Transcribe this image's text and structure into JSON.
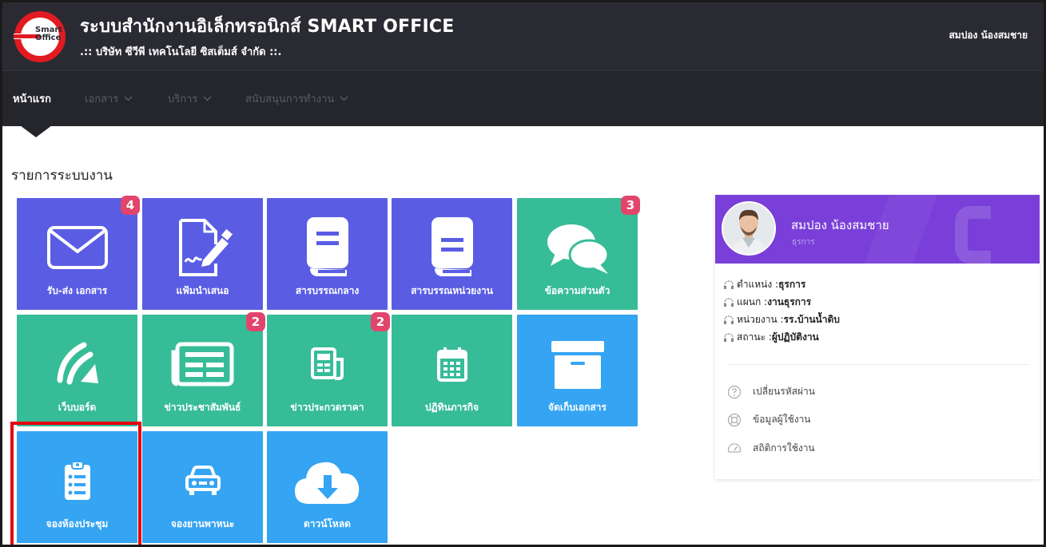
{
  "header": {
    "logo_text_top": "Smart",
    "logo_text_bottom": "Office",
    "title": "ระบบสำนักงานอิเล็กทรอนิกส์ SMART OFFICE",
    "company": ".:: บริษัท ซีวีพี เทคโนโลยี ซิสเต็มส์ จำกัด ::.",
    "user": "สมปอง น้องสมชาย"
  },
  "nav": {
    "items": [
      {
        "label": "หน้าแรก",
        "active": true
      },
      {
        "label": "เอกสาร"
      },
      {
        "label": "บริการ"
      },
      {
        "label": "สนับสนุนการทำงาน"
      }
    ]
  },
  "section_title": "รายการระบบงาน",
  "tiles": [
    {
      "label": "รับ-ส่ง เอกสาร",
      "icon": "envelope-icon",
      "color": "#5a5de3",
      "badge": "4"
    },
    {
      "label": "แฟ้มนำเสนอ",
      "icon": "document-sign-icon",
      "color": "#5a5de3"
    },
    {
      "label": "สารบรรณกลาง",
      "icon": "book-icon",
      "color": "#5a5de3"
    },
    {
      "label": "สารบรรณหน่วยงาน",
      "icon": "book-icon",
      "color": "#5a5de3"
    },
    {
      "label": "ข้อความส่วนตัว",
      "icon": "chat-bubbles-icon",
      "color": "#37bc98",
      "badge": "3"
    },
    {
      "label": "เว็บบอร์ด",
      "icon": "webboard-icon",
      "color": "#37bc98"
    },
    {
      "label": "ข่าวประชาสัมพันธ์",
      "icon": "newspaper-icon",
      "color": "#37bc98",
      "badge": "2"
    },
    {
      "label": "ข่าวประกวดราคา",
      "icon": "newspaper-small-icon",
      "color": "#37bc98",
      "badge": "2"
    },
    {
      "label": "ปฏิทินภารกิจ",
      "icon": "calendar-icon",
      "color": "#37bc98"
    },
    {
      "label": "จัดเก็บเอกสาร",
      "icon": "archive-box-icon",
      "color": "#35a4f2"
    },
    {
      "label": "จองห้องประชุม",
      "icon": "clipboard-list-icon",
      "color": "#35a4f2",
      "highlighted": true
    },
    {
      "label": "จองยานพาหนะ",
      "icon": "car-icon",
      "color": "#35a4f2"
    },
    {
      "label": "ดาวน์โหลด",
      "icon": "cloud-download-icon",
      "color": "#35a4f2"
    }
  ],
  "profile": {
    "name": "สมปอง น้องสมชาย",
    "role": "ธุรการ",
    "info": [
      {
        "label": "ตำแหน่ง : ",
        "value": "ธุรการ"
      },
      {
        "label": "แผนก : ",
        "value": "งานธุรการ"
      },
      {
        "label": "หน่วยงาน : ",
        "value": "รร.บ้านน้ำดิบ"
      },
      {
        "label": "สถานะ : ",
        "value": "ผู้ปฏิบัติงาน"
      }
    ],
    "links": [
      {
        "label": "เปลี่ยนรหัสผ่าน",
        "icon": "question-circle-icon"
      },
      {
        "label": "ข้อมูลผู้ใช้งาน",
        "icon": "lifebuoy-icon"
      },
      {
        "label": "สถิติการใช้งาน",
        "icon": "speedometer-icon"
      }
    ]
  }
}
